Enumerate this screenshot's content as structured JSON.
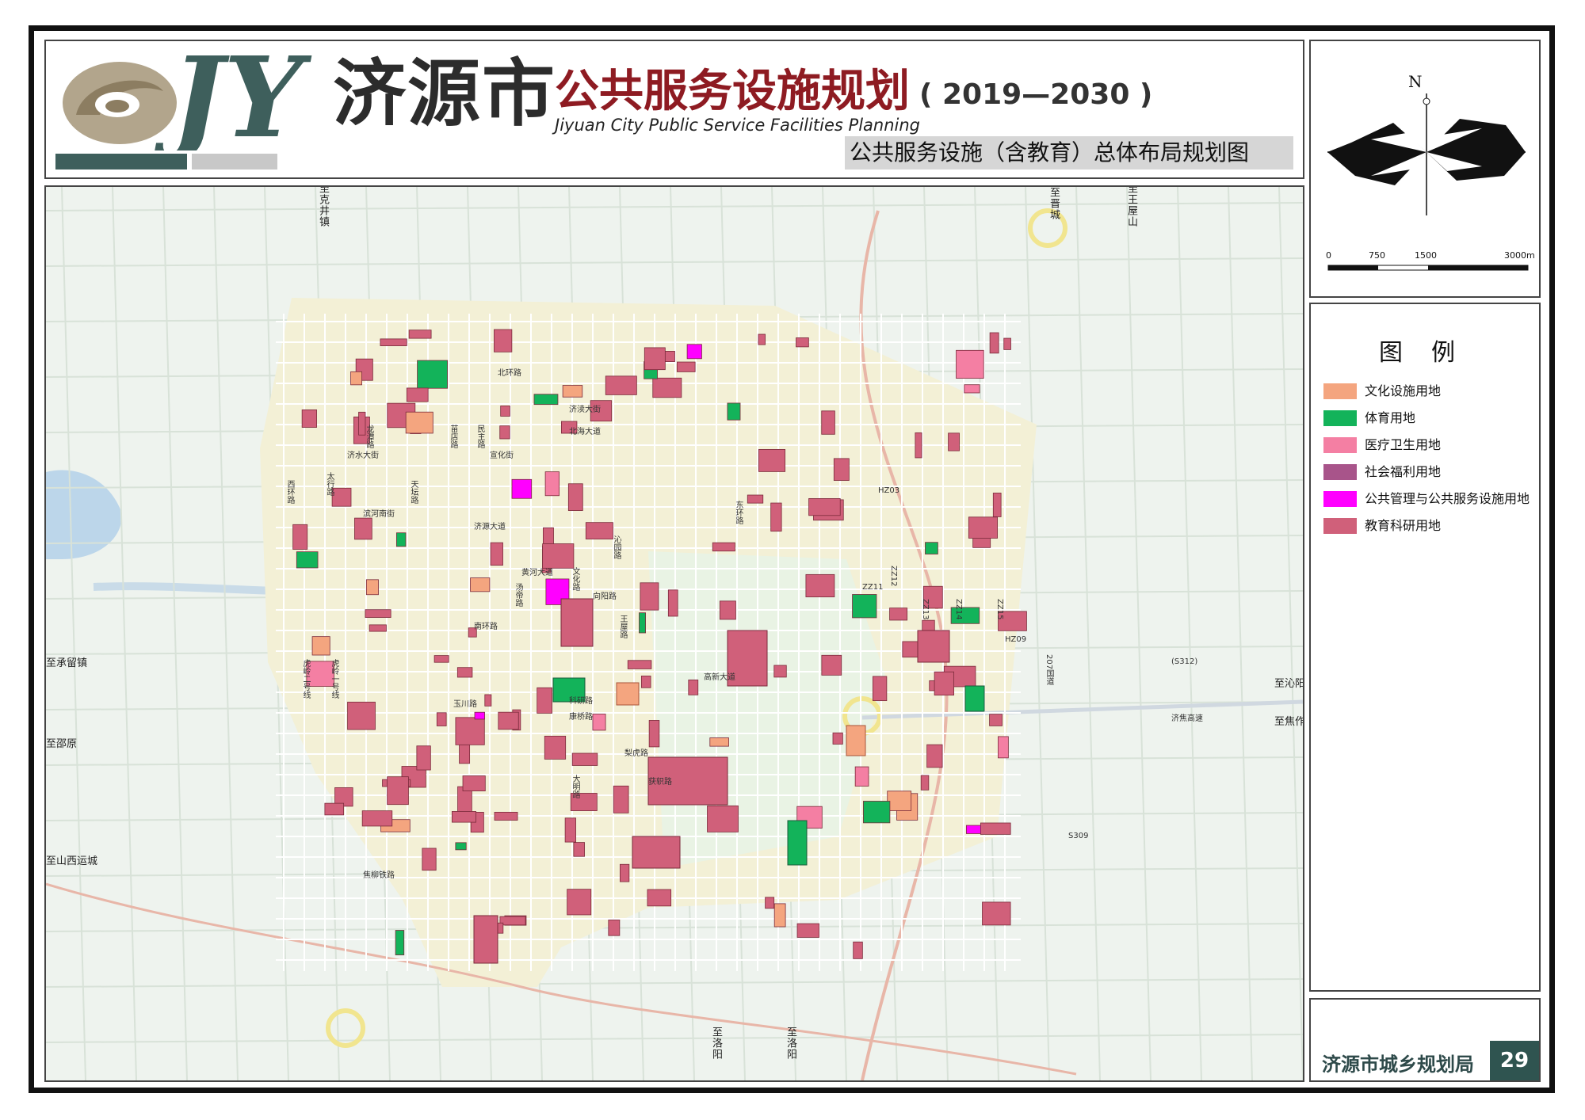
{
  "header": {
    "city": "济源市",
    "plan": "公共服务设施规划",
    "years": "( 2019—2030 )",
    "english": "Jiyuan City Public Service Facilities Planning",
    "subtitle": "公共服务设施（含教育）总体布局规划图",
    "logo_text": "JY"
  },
  "compass": {
    "north": "N",
    "scale_labels": [
      "0",
      "750",
      "1500",
      "3000m"
    ]
  },
  "legend": {
    "title": "图例",
    "items": [
      {
        "label": "文化设施用地",
        "color": "#f4a57f"
      },
      {
        "label": "体育用地",
        "color": "#13b35a"
      },
      {
        "label": "医疗卫生用地",
        "color": "#f47fa3"
      },
      {
        "label": "社会福利用地",
        "color": "#a8548a"
      },
      {
        "label": "公共管理与公共服务设施用地",
        "color": "#ff00ff"
      },
      {
        "label": "教育科研用地",
        "color": "#d0607a"
      }
    ]
  },
  "footer": {
    "org": "济源市城乡规划局",
    "page": "29"
  },
  "map": {
    "destinations": [
      {
        "text": "至克井镇",
        "vertical": true
      },
      {
        "text": "至晋城",
        "vertical": true
      },
      {
        "text": "至王屋山",
        "vertical": true
      },
      {
        "text": "至承留镇",
        "vertical": false
      },
      {
        "text": "至沁阳",
        "vertical": false
      },
      {
        "text": "至焦作",
        "vertical": false
      },
      {
        "text": "至邵原",
        "vertical": false
      },
      {
        "text": "至山西运城",
        "vertical": false
      },
      {
        "text": "至洛阳",
        "vertical": true
      },
      {
        "text": "至洛阳",
        "vertical": true
      }
    ],
    "roads": [
      {
        "text": "北环路",
        "vertical": false
      },
      {
        "text": "济渎大街",
        "vertical": false
      },
      {
        "text": "北海大道",
        "vertical": false
      },
      {
        "text": "济水大街",
        "vertical": false
      },
      {
        "text": "滨河南街",
        "vertical": false
      },
      {
        "text": "黄河大道",
        "vertical": false
      },
      {
        "text": "南环路",
        "vertical": false
      },
      {
        "text": "科研路",
        "vertical": false
      },
      {
        "text": "康桥路",
        "vertical": false
      },
      {
        "text": "获轵路",
        "vertical": false
      },
      {
        "text": "梨虎路",
        "vertical": false
      },
      {
        "text": "大明路",
        "vertical": true
      },
      {
        "text": "文化路",
        "vertical": true
      },
      {
        "text": "玉川路",
        "vertical": false
      },
      {
        "text": "东环路",
        "vertical": true
      },
      {
        "text": "西环路",
        "vertical": true
      },
      {
        "text": "虎岭二号线",
        "vertical": true
      },
      {
        "text": "虎岭一号线",
        "vertical": true
      },
      {
        "text": "天坛路",
        "vertical": true
      },
      {
        "text": "宣化街",
        "vertical": false
      },
      {
        "text": "沁园路",
        "vertical": true
      },
      {
        "text": "王屋路",
        "vertical": true
      },
      {
        "text": "汤帝路",
        "vertical": true
      },
      {
        "text": "龙潭路",
        "vertical": true
      },
      {
        "text": "民主路",
        "vertical": true
      },
      {
        "text": "苗店路",
        "vertical": true
      },
      {
        "text": "济源大道",
        "vertical": false
      },
      {
        "text": "高新大道",
        "vertical": false
      },
      {
        "text": "太行路",
        "vertical": true
      },
      {
        "text": "向阳路",
        "vertical": false
      },
      {
        "text": "HZ03",
        "vertical": false
      },
      {
        "text": "HZ09",
        "vertical": false
      },
      {
        "text": "ZZ11",
        "vertical": false
      },
      {
        "text": "ZZ12",
        "vertical": true
      },
      {
        "text": "ZZ13",
        "vertical": true
      },
      {
        "text": "ZZ14",
        "vertical": true
      },
      {
        "text": "ZZ15",
        "vertical": true
      },
      {
        "text": "207国道",
        "vertical": true
      },
      {
        "text": "济焦高速",
        "vertical": false
      },
      {
        "text": "(S312)",
        "vertical": false
      },
      {
        "text": "S309",
        "vertical": false
      },
      {
        "text": "焦柳铁路",
        "vertical": false
      }
    ]
  }
}
